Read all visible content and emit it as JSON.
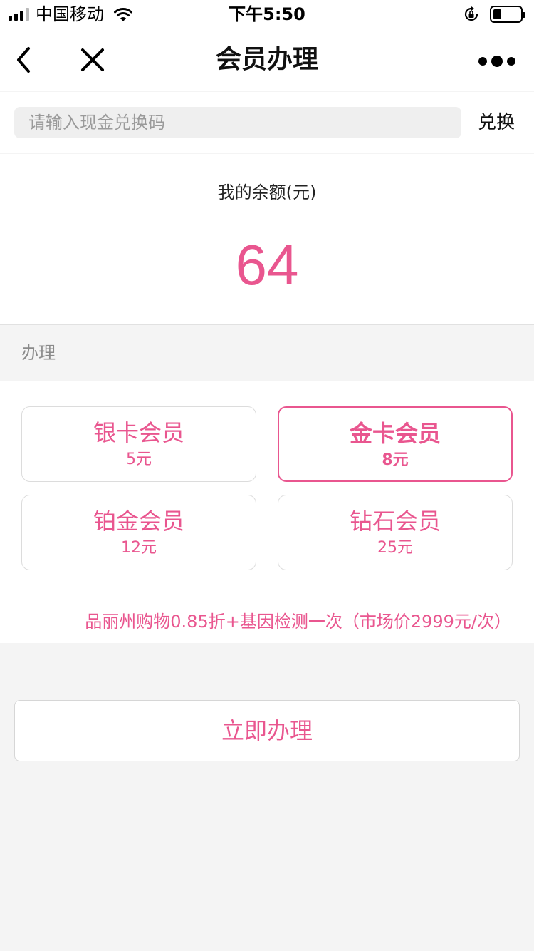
{
  "status_bar": {
    "carrier": "中国移动",
    "time": "下午5:50",
    "signal_bars": 3,
    "battery_level": 0.3,
    "icons": [
      "signal-icon",
      "wifi-icon",
      "rotation-lock-icon",
      "battery-icon"
    ]
  },
  "nav": {
    "title": "会员办理",
    "back_icon": "chevron-left-icon",
    "close_icon": "close-icon",
    "more_icon": "more-dots-icon"
  },
  "redeem": {
    "placeholder": "请输入现金兑换码",
    "value": "",
    "button_label": "兑换"
  },
  "balance": {
    "label": "我的余额(元)",
    "value": "64"
  },
  "section": {
    "title": "办理"
  },
  "memberships": [
    {
      "name": "银卡会员",
      "price": "5元",
      "selected": false
    },
    {
      "name": "金卡会员",
      "price": "8元",
      "selected": true
    },
    {
      "name": "铂金会员",
      "price": "12元",
      "selected": false
    },
    {
      "name": "钻石会员",
      "price": "25元",
      "selected": false
    }
  ],
  "benefit_text": "品丽州购物0.85折+基因检测一次（市场价2999元/次）",
  "submit_label": "立即办理",
  "colors": {
    "accent": "#e9568f",
    "page_background": "#f4f4f4",
    "card_border": "#dcdcdc"
  }
}
